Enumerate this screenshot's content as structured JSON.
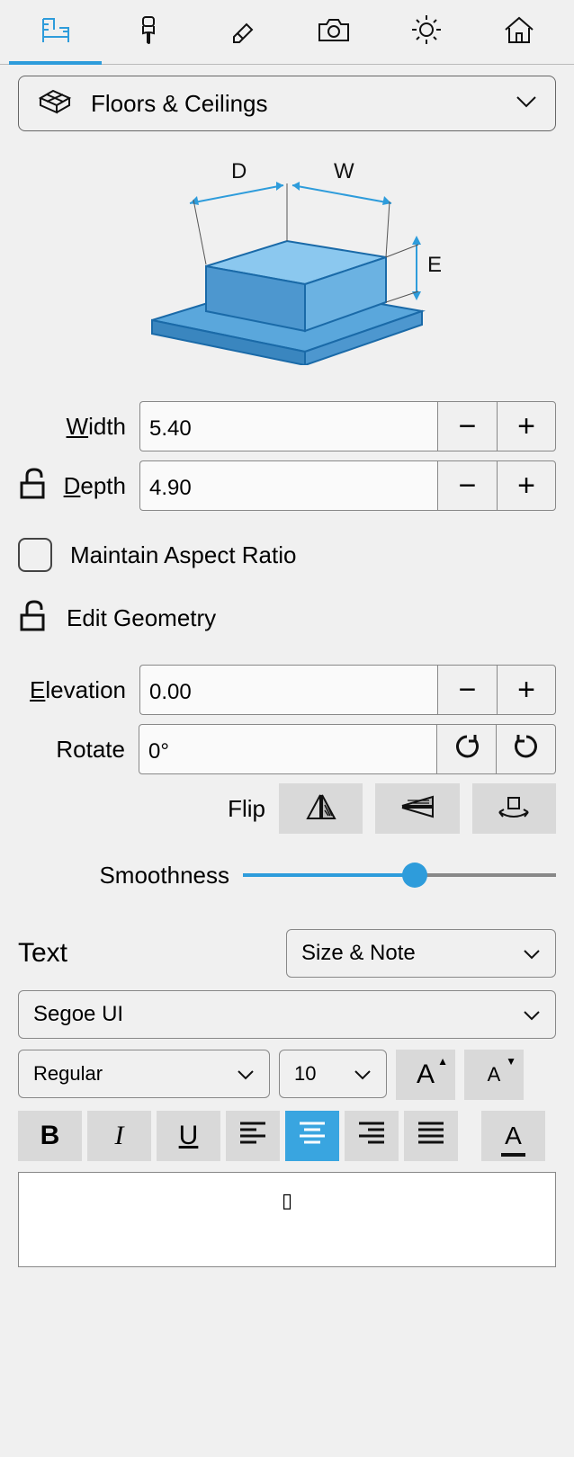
{
  "tabs": {
    "active_index": 0,
    "items": [
      "properties",
      "materials",
      "edit",
      "camera",
      "lighting",
      "structure"
    ]
  },
  "category": {
    "label": "Floors & Ceilings"
  },
  "diagram": {
    "labels": {
      "d": "D",
      "w": "W",
      "e": "E"
    }
  },
  "dimensions": {
    "width_label_pre": "W",
    "width_label_post": "idth",
    "width_label_u": "W",
    "width_value": "5.40",
    "depth_label_pre": "D",
    "depth_label_post": "epth",
    "depth_value": "4.90",
    "locked": false
  },
  "aspect": {
    "label": "Maintain Aspect Ratio",
    "checked": false
  },
  "edit_geometry": {
    "label": "Edit Geometry",
    "locked": false
  },
  "elevation": {
    "label_pre": "E",
    "label_post": "levation",
    "value": "0.00"
  },
  "rotate": {
    "label": "Rotate",
    "value": "0°"
  },
  "flip": {
    "label": "Flip"
  },
  "smoothness": {
    "label": "Smoothness",
    "value_pct": 55
  },
  "text": {
    "heading": "Text",
    "mode_label": "Size & Note",
    "font": "Segoe UI",
    "style": "Regular",
    "size": "10",
    "content": "▯"
  }
}
